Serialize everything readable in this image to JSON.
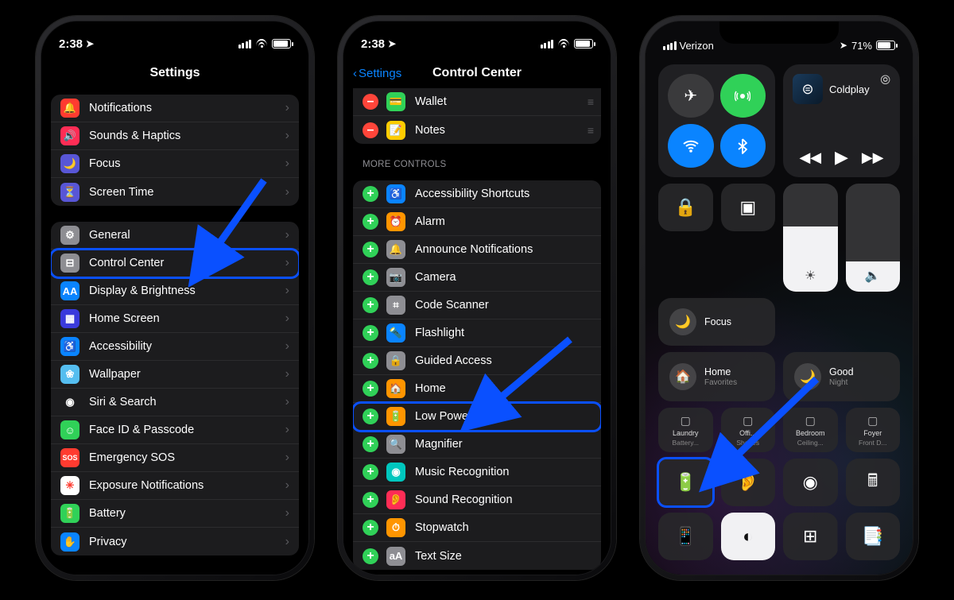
{
  "status": {
    "time": "2:38",
    "carrier": "Verizon",
    "battery_pct": "71%",
    "battery_fill_pct": 80,
    "battery_fill_pct_cc": 71
  },
  "phone1": {
    "title": "Settings",
    "group1": [
      {
        "label": "Notifications",
        "icon": "🔔",
        "color": "#ff3b30"
      },
      {
        "label": "Sounds & Haptics",
        "icon": "🔊",
        "color": "#ff2d55"
      },
      {
        "label": "Focus",
        "icon": "🌙",
        "color": "#5856d6"
      },
      {
        "label": "Screen Time",
        "icon": "⏳",
        "color": "#5856d6"
      }
    ],
    "group2": [
      {
        "label": "General",
        "icon": "⚙",
        "color": "#8e8e93"
      },
      {
        "label": "Control Center",
        "icon": "⊟",
        "color": "#8e8e93",
        "highlight": true
      },
      {
        "label": "Display & Brightness",
        "icon": "AA",
        "color": "#0a84ff"
      },
      {
        "label": "Home Screen",
        "icon": "▦",
        "color": "#3a3adc"
      },
      {
        "label": "Accessibility",
        "icon": "♿",
        "color": "#0a84ff"
      },
      {
        "label": "Wallpaper",
        "icon": "❀",
        "color": "#55bef0"
      },
      {
        "label": "Siri & Search",
        "icon": "◉",
        "color": "#1c1c1e"
      },
      {
        "label": "Face ID & Passcode",
        "icon": "☺",
        "color": "#30d158"
      },
      {
        "label": "Emergency SOS",
        "icon": "SOS",
        "color": "#ff3b30"
      },
      {
        "label": "Exposure Notifications",
        "icon": "✳",
        "color": "#ffffff",
        "fg": "#ff3b30"
      },
      {
        "label": "Battery",
        "icon": "🔋",
        "color": "#30d158"
      },
      {
        "label": "Privacy",
        "icon": "✋",
        "color": "#0a84ff"
      }
    ]
  },
  "phone2": {
    "title": "Control Center",
    "back": "Settings",
    "included": [
      {
        "label": "Wallet",
        "icon": "💳",
        "color": "#30d158"
      },
      {
        "label": "Notes",
        "icon": "📝",
        "color": "#ffcc00"
      }
    ],
    "section_label": "MORE CONTROLS",
    "more": [
      {
        "label": "Accessibility Shortcuts",
        "icon": "♿",
        "color": "#0a84ff"
      },
      {
        "label": "Alarm",
        "icon": "⏰",
        "color": "#ff9500"
      },
      {
        "label": "Announce Notifications",
        "icon": "🔔",
        "color": "#8e8e93"
      },
      {
        "label": "Camera",
        "icon": "📷",
        "color": "#8e8e93"
      },
      {
        "label": "Code Scanner",
        "icon": "⌗",
        "color": "#8e8e93"
      },
      {
        "label": "Flashlight",
        "icon": "🔦",
        "color": "#0a84ff"
      },
      {
        "label": "Guided Access",
        "icon": "🔒",
        "color": "#8e8e93"
      },
      {
        "label": "Home",
        "icon": "🏠",
        "color": "#ff9500"
      },
      {
        "label": "Low Power Mode",
        "icon": "🔋",
        "color": "#ff9500",
        "highlight": true
      },
      {
        "label": "Magnifier",
        "icon": "🔍",
        "color": "#8e8e93"
      },
      {
        "label": "Music Recognition",
        "icon": "◉",
        "color": "#00c7be"
      },
      {
        "label": "Sound Recognition",
        "icon": "👂",
        "color": "#ff2d55"
      },
      {
        "label": "Stopwatch",
        "icon": "⏱",
        "color": "#ff9500"
      },
      {
        "label": "Text Size",
        "icon": "aA",
        "color": "#8e8e93"
      }
    ]
  },
  "phone3": {
    "media": {
      "artist": "Coldplay",
      "airplay": "⦿"
    },
    "conn": {
      "airplane": {
        "glyph": "✈",
        "bg": "#3a3a3c"
      },
      "cell": {
        "glyph": "📶",
        "bg": "#30d158"
      },
      "wifi": {
        "glyph": "ᯤ",
        "bg": "#0a84ff"
      },
      "bt": {
        "glyph": "⌵",
        "bg": "#0a84ff"
      }
    },
    "lock": "🔒",
    "mirror": "▣",
    "focus_label": "Focus",
    "brightness_pct": 60,
    "volume_pct": 28,
    "home_fav": {
      "title": "Home",
      "sub": "Favorites"
    },
    "good_night": {
      "title": "Good",
      "sub": "Night"
    },
    "shortcut_row": [
      {
        "title": "Laundry",
        "sub": "Battery..."
      },
      {
        "title": "Offi...",
        "sub": "Shapes"
      },
      {
        "title": "Bedroom",
        "sub": "Ceiling..."
      },
      {
        "title": "Foyer",
        "sub": "Front D..."
      }
    ],
    "bottom_row": [
      "🔋",
      "👂",
      "◉",
      "🖩"
    ],
    "last_row": [
      "📱",
      "◐",
      "⊞",
      "📑"
    ]
  }
}
